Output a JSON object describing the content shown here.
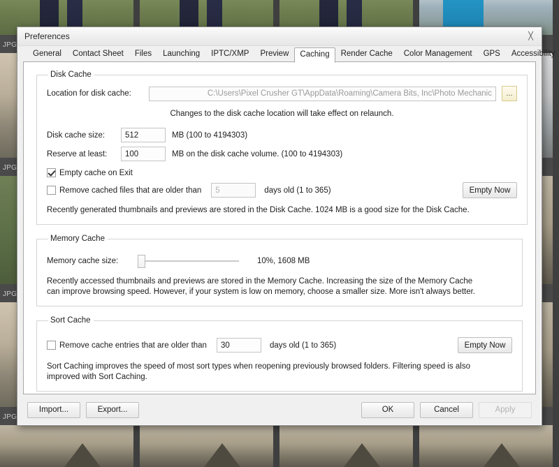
{
  "background": {
    "thumbnails": [
      {
        "label": "JPG",
        "style": "ph-a"
      },
      {
        "label": "JPG",
        "style": "ph-c"
      },
      {
        "label": "JPG",
        "style": "ph-e"
      },
      {
        "label": "JPG",
        "style": "ph-b"
      },
      {
        "label": "JPG",
        "style": "ph-d"
      },
      {
        "label": "JPG",
        "style": "ph-f"
      }
    ]
  },
  "dialog": {
    "title": "Preferences",
    "close_icon": "close-icon",
    "tabs": [
      {
        "label": "General",
        "active": false
      },
      {
        "label": "Contact Sheet",
        "active": false
      },
      {
        "label": "Files",
        "active": false
      },
      {
        "label": "Launching",
        "active": false
      },
      {
        "label": "IPTC/XMP",
        "active": false
      },
      {
        "label": "Preview",
        "active": false
      },
      {
        "label": "Caching",
        "active": true
      },
      {
        "label": "Render Cache",
        "active": false
      },
      {
        "label": "Color Management",
        "active": false
      },
      {
        "label": "GPS",
        "active": false
      },
      {
        "label": "Accessibility",
        "active": false
      }
    ]
  },
  "disk_cache": {
    "legend": "Disk Cache",
    "location_label": "Location for disk cache:",
    "location_value": "C:\\Users\\Pixel Crusher GT\\AppData\\Roaming\\Camera Bits, Inc\\Photo Mechanic",
    "browse_label": "...",
    "relaunch_note": "Changes to the disk cache location will take effect on relaunch.",
    "size_label": "Disk cache size:",
    "size_value": "512",
    "size_units": "MB (100 to 4194303)",
    "reserve_label": "Reserve at least:",
    "reserve_value": "100",
    "reserve_units": "MB on the disk cache volume. (100 to 4194303)",
    "empty_on_exit_label": "Empty cache on Exit",
    "empty_on_exit_checked": true,
    "remove_older_label": "Remove cached files that are older than",
    "remove_older_checked": false,
    "remove_older_value": "5",
    "remove_older_units": "days old (1 to 365)",
    "empty_now_label": "Empty Now",
    "footer_note": "Recently generated thumbnails and previews are stored in the Disk Cache.   1024 MB is a good size for the Disk Cache."
  },
  "memory_cache": {
    "legend": "Memory Cache",
    "size_label": "Memory cache size:",
    "slider_percent": 10,
    "slider_value_text": "10%, 1608 MB",
    "note": "Recently accessed thumbnails and previews are stored in the Memory Cache.  Increasing the size of the Memory Cache can improve browsing speed.  However, if your system is low on memory, choose a smaller size.  More isn't always better."
  },
  "sort_cache": {
    "legend": "Sort Cache",
    "remove_label": "Remove cache entries that are older than",
    "remove_checked": false,
    "remove_value": "30",
    "remove_units": "days old (1 to 365)",
    "empty_now_label": "Empty Now",
    "note": "Sort Caching improves the speed of most sort types when reopening previously browsed folders.  Filtering speed is also improved with Sort Caching."
  },
  "footer": {
    "import_label": "Import...",
    "export_label": "Export...",
    "ok_label": "OK",
    "cancel_label": "Cancel",
    "apply_label": "Apply",
    "apply_disabled": true
  }
}
